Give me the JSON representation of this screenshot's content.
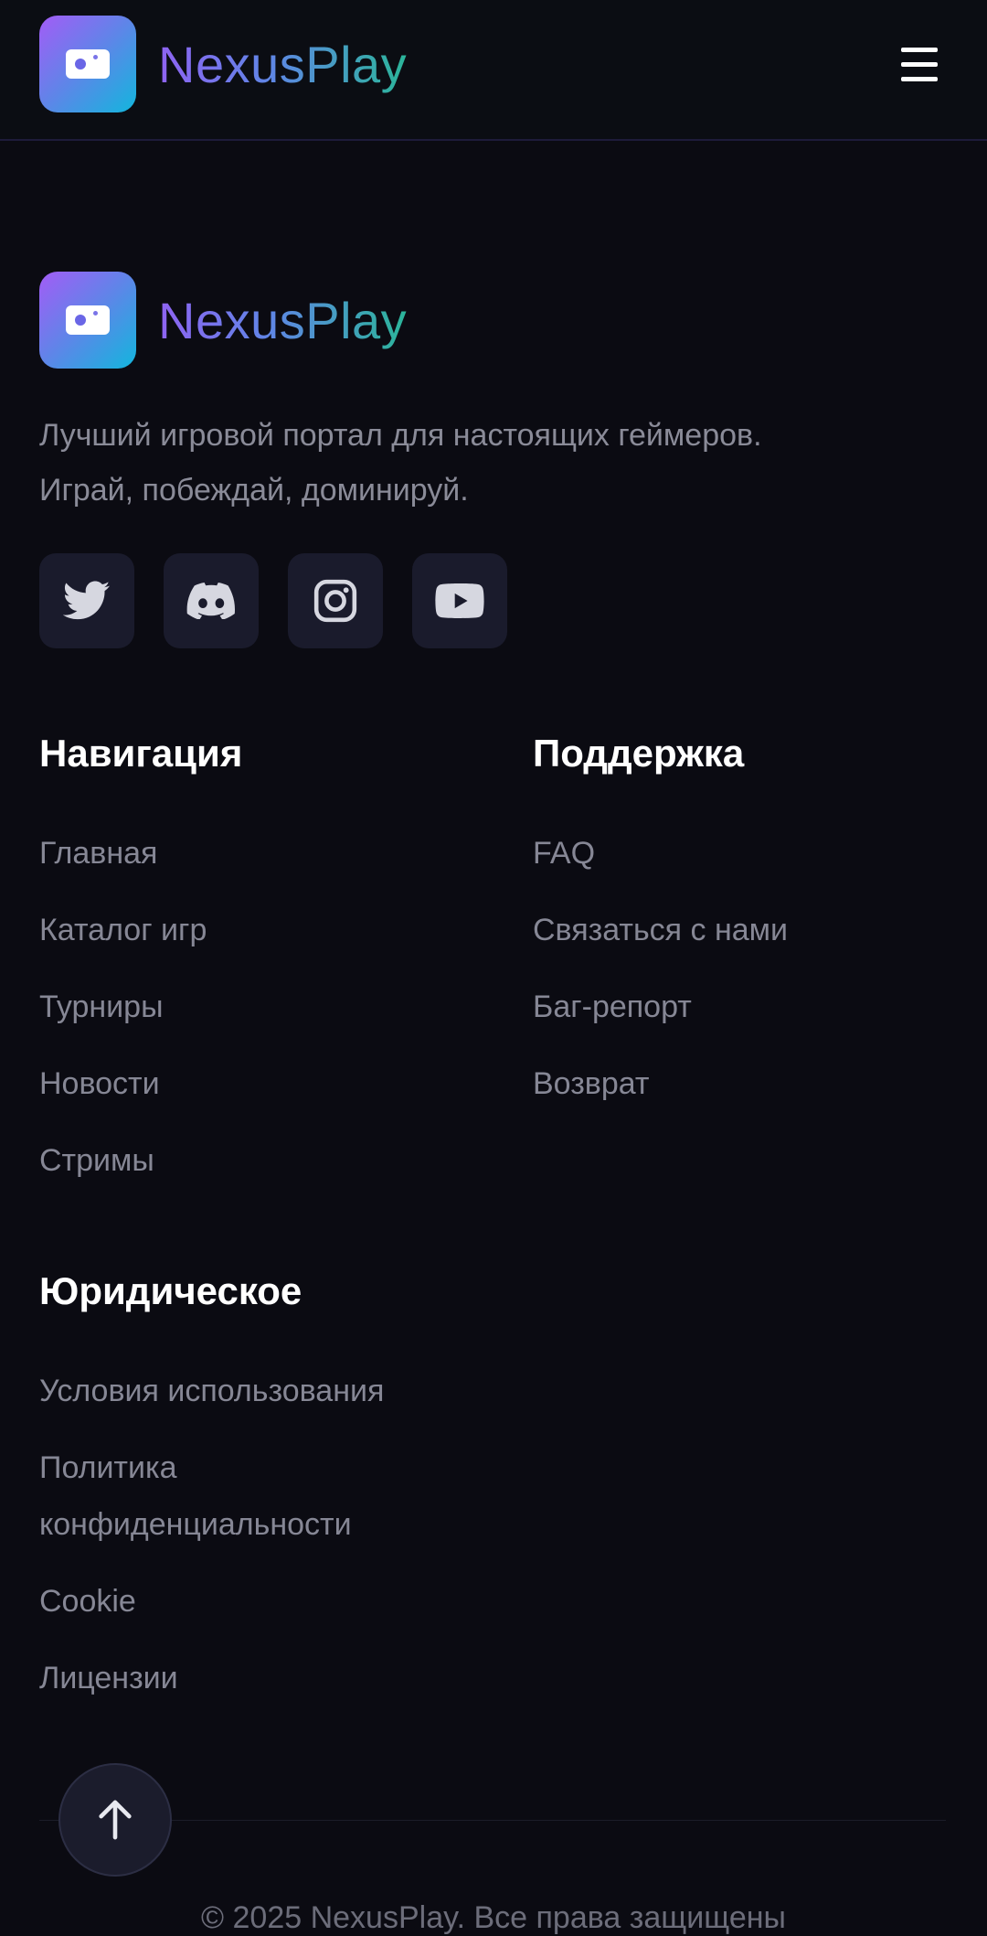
{
  "header": {
    "brand": "NexusPlay",
    "menu_icon": "hamburger-menu-icon"
  },
  "footer": {
    "brand": "NexusPlay",
    "tagline_line1": "Лучший игровой портал для настоящих геймеров.",
    "tagline_line2": "Играй, побеждай, доминируй.",
    "socials": [
      {
        "icon": "twitter-icon"
      },
      {
        "icon": "discord-icon"
      },
      {
        "icon": "instagram-icon"
      },
      {
        "icon": "youtube-icon"
      }
    ],
    "navigation": {
      "title": "Навигация",
      "links": [
        "Главная",
        "Каталог игр",
        "Турниры",
        "Новости",
        "Стримы"
      ]
    },
    "support": {
      "title": "Поддержка",
      "links": [
        "FAQ",
        "Связаться с нами",
        "Баг-репорт",
        "Возврат"
      ]
    },
    "legal": {
      "title": "Юридическое",
      "links": [
        "Условия использования",
        "Политика",
        "конфиденциальности",
        "Cookie",
        "Лицензии"
      ]
    },
    "scroll_top_icon": "arrow-up-icon",
    "copyright": "© 2025 NexusPlay. Все права защищены"
  }
}
